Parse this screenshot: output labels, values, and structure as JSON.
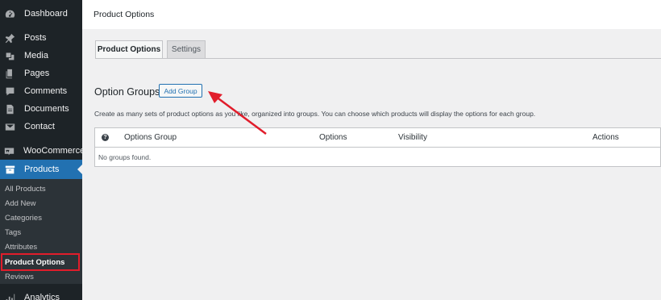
{
  "sidebar": {
    "menu": [
      {
        "label": "Dashboard",
        "icon": "dashboard-icon"
      },
      {
        "label": "Posts",
        "icon": "pin-icon"
      },
      {
        "label": "Media",
        "icon": "media-icon"
      },
      {
        "label": "Pages",
        "icon": "pages-icon"
      },
      {
        "label": "Comments",
        "icon": "comment-icon"
      },
      {
        "label": "Documents",
        "icon": "document-icon"
      },
      {
        "label": "Contact",
        "icon": "mail-icon"
      },
      {
        "label": "WooCommerce",
        "icon": "woo-icon"
      },
      {
        "label": "Products",
        "icon": "archive-icon"
      },
      {
        "label": "Analytics",
        "icon": "bar-chart-icon"
      }
    ],
    "submenu": [
      "All Products",
      "Add New",
      "Categories",
      "Tags",
      "Attributes",
      "Product Options",
      "Reviews"
    ],
    "active_menu": "Products",
    "current_submenu": "Product Options"
  },
  "topbar": {
    "title": "Product Options"
  },
  "tabs": [
    {
      "label": "Product Options",
      "active": true
    },
    {
      "label": "Settings",
      "active": false
    }
  ],
  "section": {
    "title": "Option Groups",
    "add_button": "Add Group",
    "description": "Create as many sets of product options as you like, organized into groups. You can choose which products will display the options for each group."
  },
  "table": {
    "help_glyph": "?",
    "columns": [
      "Options Group",
      "Options",
      "Visibility",
      "Actions"
    ],
    "empty_message": "No groups found."
  },
  "colors": {
    "sidebar_bg": "#1d2327",
    "active_bg": "#2271b1",
    "annotation": "#e11d2b"
  }
}
